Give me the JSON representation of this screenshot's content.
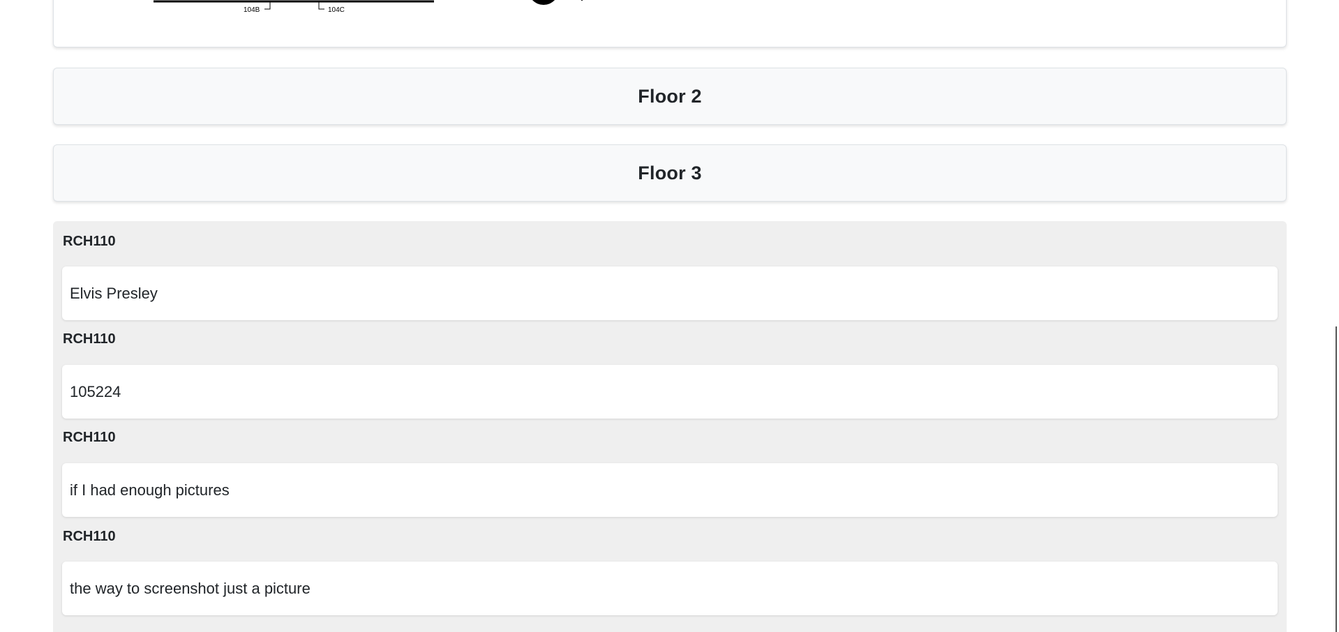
{
  "floorplan": {
    "labels": [
      "104B",
      "104C"
    ]
  },
  "floors": [
    {
      "title": "Floor 2"
    },
    {
      "title": "Floor 3"
    }
  ],
  "notes": [
    {
      "room": "RCH110",
      "text": "Elvis Presley"
    },
    {
      "room": "RCH110",
      "text": "105224"
    },
    {
      "room": "RCH110",
      "text": "if I had enough pictures"
    },
    {
      "room": "RCH110",
      "text": "the way to screenshot just a picture"
    }
  ]
}
